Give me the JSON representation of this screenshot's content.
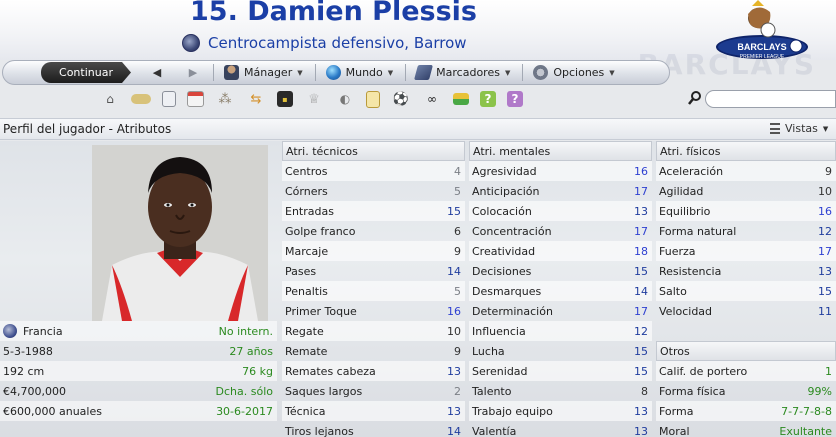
{
  "header": {
    "title": "15. Damien Plessis",
    "subtitle": "Centrocampista defensivo, Barrow",
    "logo_text": "BARCLAYS",
    "logo_subtext": "PREMIER LEAGUE",
    "bg_text": "BARCLAYS"
  },
  "toolbar": {
    "continue_label": "Continuar",
    "menus": [
      {
        "label": "Mánager",
        "icon": "manager-icon"
      },
      {
        "label": "Mundo",
        "icon": "globe-icon"
      },
      {
        "label": "Marcadores",
        "icon": "bookmarks-icon"
      },
      {
        "label": "Opciones",
        "icon": "options-icon"
      }
    ]
  },
  "iconbar": {
    "icons": [
      "home-icon",
      "bread-icon",
      "notebook-icon",
      "calendar-icon",
      "people-icon",
      "transfer-icon",
      "tactics-icon",
      "trophy-icon",
      "whistle-icon",
      "clipboard-icon",
      "ball-icon",
      "binoculars-icon",
      "money-icon",
      "help-icon",
      "question-icon"
    ]
  },
  "search": {
    "placeholder": ""
  },
  "section": {
    "title": "Perfil del jugador - Atributos",
    "views_label": "Vistas"
  },
  "info_rows": [
    {
      "label": "Francia",
      "value": "No intern.",
      "icon": true
    },
    {
      "label": "5-3-1988",
      "value": "27 años"
    },
    {
      "label": "192 cm",
      "value": "76 kg"
    },
    {
      "label": "€4,700,000",
      "value": "Dcha. sólo"
    },
    {
      "label": "€600,000 anuales",
      "value": "30-6-2017"
    }
  ],
  "tecnicos": {
    "header": "Atri. técnicos",
    "rows": [
      {
        "name": "Centros",
        "value": "4"
      },
      {
        "name": "Córners",
        "value": "5"
      },
      {
        "name": "Entradas",
        "value": "15"
      },
      {
        "name": "Golpe franco",
        "value": "6"
      },
      {
        "name": "Marcaje",
        "value": "9"
      },
      {
        "name": "Pases",
        "value": "14"
      },
      {
        "name": "Penaltis",
        "value": "5"
      },
      {
        "name": "Primer Toque",
        "value": "16"
      },
      {
        "name": "Regate",
        "value": "10"
      },
      {
        "name": "Remate",
        "value": "9"
      },
      {
        "name": "Remates cabeza",
        "value": "13"
      },
      {
        "name": "Saques largos",
        "value": "2"
      },
      {
        "name": "Técnica",
        "value": "13"
      },
      {
        "name": "Tiros lejanos",
        "value": "14"
      }
    ]
  },
  "mentales": {
    "header": "Atri. mentales",
    "rows": [
      {
        "name": "Agresividad",
        "value": "16"
      },
      {
        "name": "Anticipación",
        "value": "17"
      },
      {
        "name": "Colocación",
        "value": "13"
      },
      {
        "name": "Concentración",
        "value": "17"
      },
      {
        "name": "Creatividad",
        "value": "18"
      },
      {
        "name": "Decisiones",
        "value": "15"
      },
      {
        "name": "Desmarques",
        "value": "14"
      },
      {
        "name": "Determinación",
        "value": "17"
      },
      {
        "name": "Influencia",
        "value": "12"
      },
      {
        "name": "Lucha",
        "value": "15"
      },
      {
        "name": "Serenidad",
        "value": "15"
      },
      {
        "name": "Talento",
        "value": "8"
      },
      {
        "name": "Trabajo equipo",
        "value": "13"
      },
      {
        "name": "Valentía",
        "value": "13"
      }
    ]
  },
  "fisicos": {
    "header": "Atri. físicos",
    "rows": [
      {
        "name": "Aceleración",
        "value": "9"
      },
      {
        "name": "Agilidad",
        "value": "10"
      },
      {
        "name": "Equilibrio",
        "value": "16"
      },
      {
        "name": "Forma natural",
        "value": "12"
      },
      {
        "name": "Fuerza",
        "value": "17"
      },
      {
        "name": "Resistencia",
        "value": "13"
      },
      {
        "name": "Salto",
        "value": "15"
      },
      {
        "name": "Velocidad",
        "value": "11"
      }
    ]
  },
  "otros": {
    "header": "Otros",
    "rows": [
      {
        "name": "Calif. de portero",
        "value": "1"
      },
      {
        "name": "Forma física",
        "value": "99%"
      },
      {
        "name": "Forma",
        "value": "7-7-7-8-8"
      },
      {
        "name": "Moral",
        "value": "Exultante"
      }
    ]
  }
}
